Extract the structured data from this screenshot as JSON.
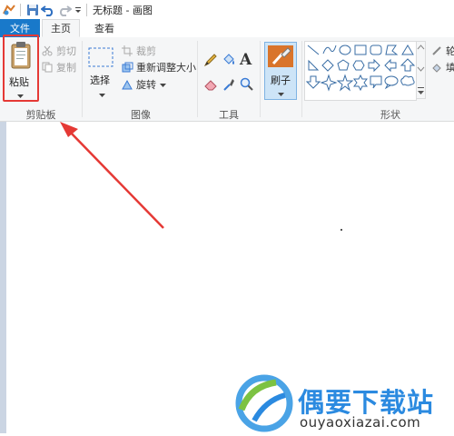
{
  "window": {
    "title": "无标题 - 画图"
  },
  "tabs": {
    "file": "文件",
    "home": "主页",
    "view": "查看"
  },
  "clipboard": {
    "paste": "粘贴",
    "cut": "剪切",
    "copy": "复制",
    "group_label": "剪贴板"
  },
  "image": {
    "select": "选择",
    "crop": "裁剪",
    "resize": "重新调整大小",
    "rotate": "旋转",
    "group_label": "图像"
  },
  "tools": {
    "group_label": "工具"
  },
  "brushes": {
    "label": "刷子"
  },
  "shapes": {
    "group_label": "形状",
    "outline_partial": "轮",
    "fill_partial": "填"
  },
  "watermark": {
    "brand": "偶要下载站",
    "url": "ouyaoxiazai.com"
  },
  "colors": {
    "accent": "#1979ca",
    "highlight": "#e53935",
    "brand": "#2b8ae0"
  }
}
